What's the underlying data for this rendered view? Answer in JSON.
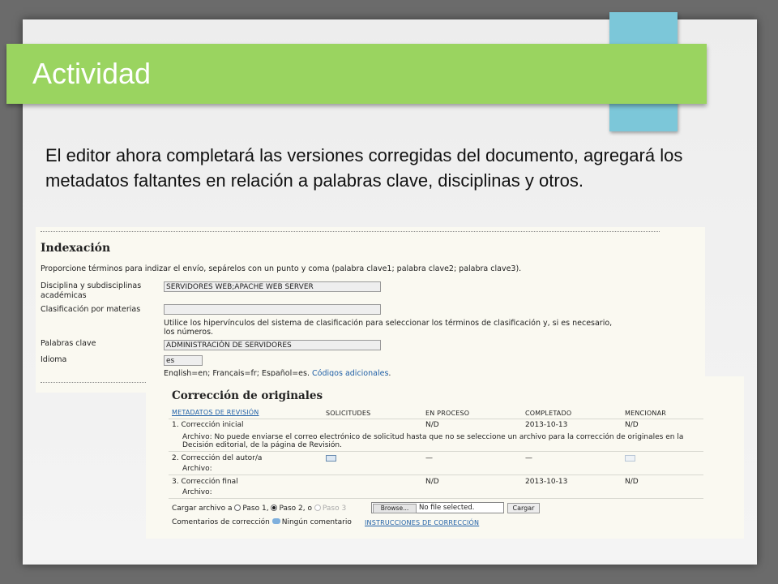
{
  "slide": {
    "title": "Actividad",
    "body": "El editor ahora completará las versiones corregidas del documento, agregará los metadatos faltantes en relación a palabras clave, disciplinas y otros.",
    "colors": {
      "title_bar": "#9ad460",
      "tab": "#7cc7d9",
      "background": "#6b6b6b"
    }
  },
  "indexacion": {
    "heading": "Indexación",
    "intro": "Proporcione términos para indizar el envío, sepárelos con un punto y coma (palabra clave1; palabra clave2; palabra clave3).",
    "disciplines_label_1": "Disciplina y subdisciplinas",
    "disciplines_label_2": "académicas",
    "disciplines_value": "SERVIDORES WEB;APACHE WEB SERVER",
    "classification_label": "Clasificación por materias",
    "classification_value": "",
    "classification_help_1": "Utilice los hipervínculos del sistema de clasificación para seleccionar los términos de clasificación y, si es necesario,",
    "classification_help_2": "los números.",
    "keywords_label": "Palabras clave",
    "keywords_value": "ADMINISTRACIÓN DE SERVIDORES",
    "language_label": "Idioma",
    "language_value": "es",
    "language_help": "English=en; Français=fr; Español=es.",
    "language_link": "Códigos adicionales",
    "language_period": "."
  },
  "correccion": {
    "heading": "Corrección de originales",
    "columns": {
      "metadata_link": "METADATOS DE REVISIÓN",
      "solicitudes": "SOLICITUDES",
      "en_proceso": "EN PROCESO",
      "completado": "COMPLETADO",
      "mencionar": "MENCIONAR"
    },
    "rows": [
      {
        "label": "1.  Corrección inicial",
        "en_proceso": "N/D",
        "completado": "2013-10-13",
        "mencionar": "N/D",
        "note_1": "Archivo: No puede enviarse el correo electrónico de solicitud hasta que no se seleccione un archivo para la corrección de originales en la",
        "note_2": "Decisión editorial, de la página de Revisión."
      },
      {
        "label": "2.  Corrección del autor/a",
        "en_proceso": "—",
        "completado": "—",
        "archivo": "Archivo:"
      },
      {
        "label": "3.  Corrección final",
        "en_proceso": "N/D",
        "completado": "2013-10-13",
        "mencionar": "N/D",
        "archivo": "Archivo:"
      }
    ],
    "upload_label": "Cargar archivo a",
    "paso1": "Paso 1,",
    "paso2": "Paso 2, o",
    "paso3": "Paso 3",
    "selected_step": "Paso 2",
    "browse": "Browse...",
    "no_file": "No file selected.",
    "upload_button": "Cargar",
    "comments_label": "Comentarios de corrección",
    "no_comment": "Ningún comentario",
    "instructions_link": "INSTRUCCIONES DE CORRECCIÓN"
  }
}
